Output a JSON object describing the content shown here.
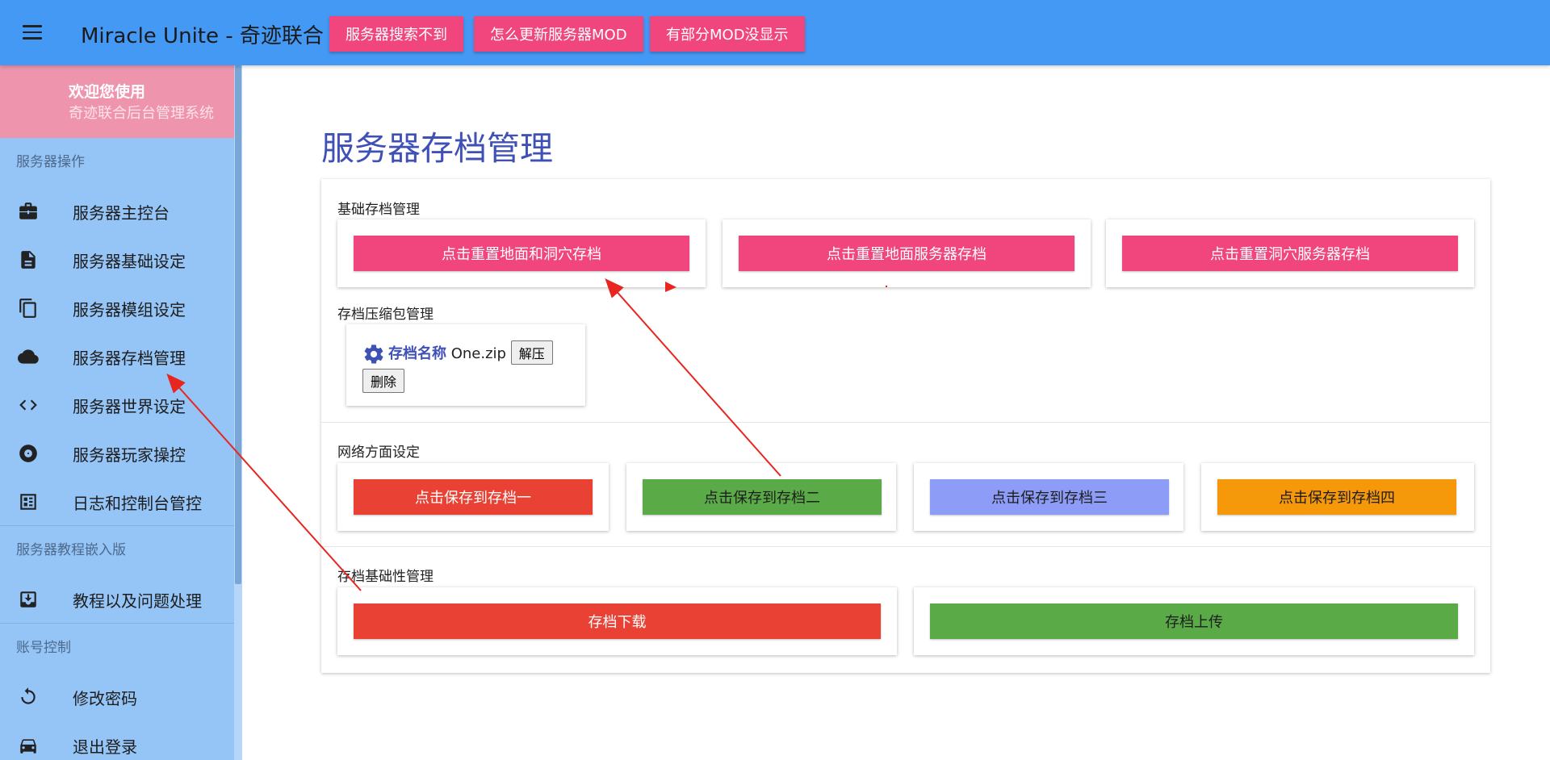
{
  "header": {
    "title": "Miracle Unite - 奇迹联合",
    "buttons": [
      "服务器搜索不到",
      "怎么更新服务器MOD",
      "有部分MOD没显示"
    ]
  },
  "sidebar": {
    "welcome_title": "欢迎您使用",
    "welcome_subtitle": "奇迹联合后台管理系统",
    "sections": [
      {
        "label": "服务器操作",
        "items": [
          {
            "label": "服务器主控台",
            "icon": "briefcase-icon"
          },
          {
            "label": "服务器基础设定",
            "icon": "document-icon"
          },
          {
            "label": "服务器模组设定",
            "icon": "copy-icon"
          },
          {
            "label": "服务器存档管理",
            "icon": "cloud-icon"
          },
          {
            "label": "服务器世界设定",
            "icon": "code-icon"
          },
          {
            "label": "服务器玩家操控",
            "icon": "disc-icon"
          },
          {
            "label": "日志和控制台管控",
            "icon": "dashboard-icon"
          }
        ]
      },
      {
        "label": "服务器教程嵌入版",
        "items": [
          {
            "label": "教程以及问题处理",
            "icon": "download-box-icon"
          }
        ]
      },
      {
        "label": "账号控制",
        "items": [
          {
            "label": "修改密码",
            "icon": "refresh-icon"
          },
          {
            "label": "退出登录",
            "icon": "car-icon"
          }
        ]
      }
    ]
  },
  "main": {
    "page_title": "服务器存档管理",
    "basic": {
      "label": "基础存档管理",
      "buttons": [
        "点击重置地面和洞穴存档",
        "点击重置地面服务器存档",
        "点击重置洞穴服务器存档"
      ]
    },
    "archives": {
      "label": "存档压缩包管理",
      "file_key": "存档名称",
      "file_name": "One.zip",
      "extract_label": "解压",
      "delete_label": "删除"
    },
    "network": {
      "label": "网络方面设定",
      "buttons": [
        "点击保存到存档一",
        "点击保存到存档二",
        "点击保存到存档三",
        "点击保存到存档四"
      ]
    },
    "transfer": {
      "label": "存档基础性管理",
      "download_label": "存档下载",
      "upload_label": "存档上传"
    }
  },
  "colors": {
    "header": "#4499f5",
    "sidebar": "#95c4f6",
    "welcome": "#ef94ad",
    "pink": "#f1457e",
    "red": "#e94235",
    "green": "#5aab47",
    "lavender": "#8c9cf7",
    "orange": "#f59809",
    "title": "#3f51b5",
    "annotation": "#e8261f"
  }
}
